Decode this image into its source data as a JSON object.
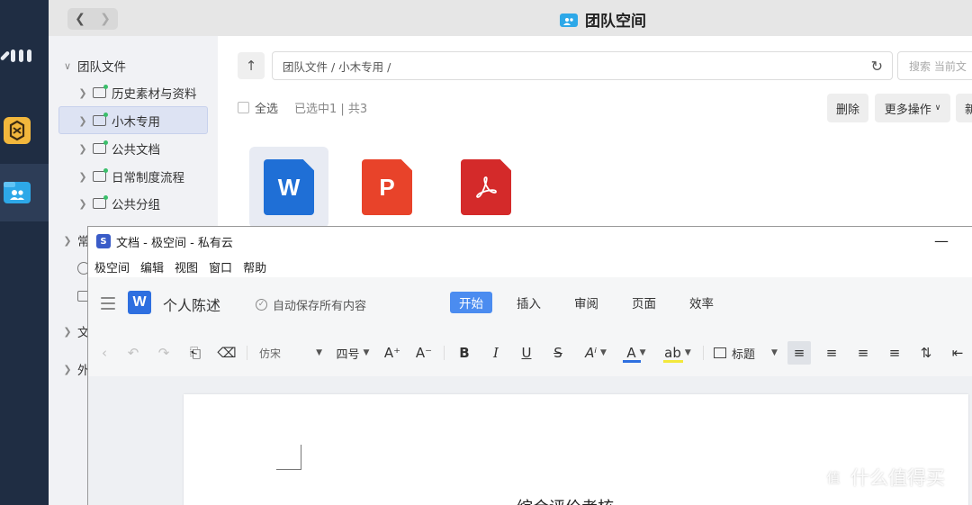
{
  "dock": {
    "items": [
      {
        "icon": "apps-grid-icon"
      },
      {
        "icon": "app-cube-icon"
      },
      {
        "icon": "team-folder-icon",
        "active": true
      }
    ]
  },
  "file_manager": {
    "title": "团队空间",
    "back_icon": "chevron-left-icon",
    "forward_icon": "chevron-right-icon",
    "sidebar": {
      "root_label": "团队文件",
      "folders": [
        "历史素材与资料",
        "小木专用",
        "公共文档",
        "日常制度流程",
        "公共分组"
      ],
      "selected_folder": "小木专用",
      "collapsed_sections": [
        "常",
        "文",
        "外"
      ]
    },
    "path": "团队文件 / 小木专用 /",
    "search_placeholder": "搜索 当前文",
    "select_all_label": "全选",
    "selection_status": "已选中1 | 共3",
    "actions": {
      "delete": "删除",
      "more": "更多操作",
      "new": "新"
    },
    "files": [
      {
        "type_letter": "W",
        "kind": "word",
        "color": "#1f6fd6"
      },
      {
        "type_letter": "P",
        "kind": "powerpoint",
        "color": "#e8432a"
      },
      {
        "type_letter": "",
        "kind": "pdf",
        "color": "#d42a2a"
      }
    ]
  },
  "editor": {
    "window_title": "文档 - 极空间 - 私有云",
    "minimize_label": "—",
    "menu": [
      "极空间",
      "编辑",
      "视图",
      "窗口",
      "帮助"
    ],
    "logo_letter": "W",
    "doc_name": "个人陈述",
    "autosave": "自动保存所有内容",
    "tabs": [
      "开始",
      "插入",
      "审阅",
      "页面",
      "效率"
    ],
    "active_tab": "开始",
    "toolbar": {
      "font": "仿宋",
      "size": "四号",
      "style": "标题",
      "font_color": "#2e6fe0",
      "highlight_color": "#f3e83c",
      "letters": {
        "grow": "A⁺",
        "shrink": "A⁻",
        "bold": "B",
        "italic": "I",
        "underline": "U",
        "strike": "S",
        "font_color": "A",
        "highlight": "ab"
      }
    },
    "doc_heading": "综合评价考核"
  },
  "watermark": {
    "badge": "值",
    "text": "什么值得买"
  }
}
